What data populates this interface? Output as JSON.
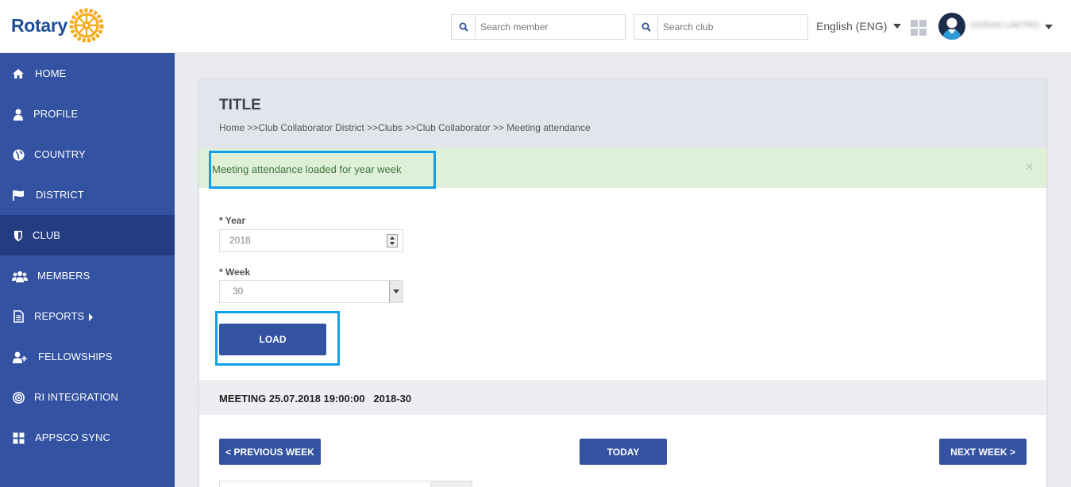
{
  "header": {
    "logo_text": "Rotary",
    "search_member_placeholder": "Search member",
    "search_club_placeholder": "Search club",
    "language": "English (ENG)",
    "user_name": "GORAN LAKTRO"
  },
  "sidebar": {
    "items": [
      {
        "label": "HOME",
        "icon": "home-icon"
      },
      {
        "label": "PROFILE",
        "icon": "user-icon"
      },
      {
        "label": "COUNTRY",
        "icon": "globe-icon"
      },
      {
        "label": "DISTRICT",
        "icon": "flag-icon"
      },
      {
        "label": "CLUB",
        "icon": "shield-icon",
        "active": true
      },
      {
        "label": "MEMBERS",
        "icon": "users-icon"
      },
      {
        "label": "REPORTS",
        "icon": "document-icon"
      },
      {
        "label": "FELLOWSHIPS",
        "icon": "user-plus-icon"
      },
      {
        "label": "RI INTEGRATION",
        "icon": "target-icon"
      },
      {
        "label": "APPSCO SYNC",
        "icon": "grid-icon"
      }
    ]
  },
  "main": {
    "title": "TITLE",
    "breadcrumb": "Home >>Club Collaborator District >>Clubs >>Club Collaborator >> Meeting attendance",
    "alert": "Meeting attendance loaded for year week",
    "alert_close": "×",
    "year_label": "* Year",
    "year_value": "2018",
    "week_label": "* Week",
    "week_value": "30",
    "load_button": "LOAD",
    "meeting_info": "MEETING 25.07.2018 19:00:00   2018-30",
    "prev_week_button": "< PREVIOUS WEEK",
    "today_button": "TODAY",
    "next_week_button": "NEXT WEEK >"
  },
  "colors": {
    "sidebar": "#3352a1",
    "sidebar_active": "#243d82",
    "button": "#3352a1",
    "alert_bg": "#dff0d8",
    "highlight": "#0ea0ec"
  }
}
